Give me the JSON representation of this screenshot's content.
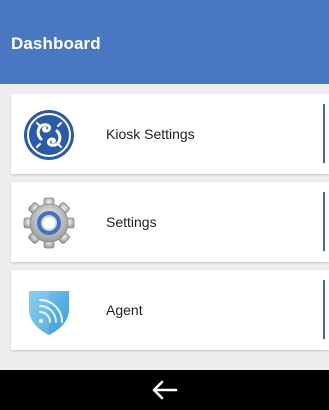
{
  "header": {
    "title": "Dashboard"
  },
  "items": [
    {
      "label": "Kiosk Settings",
      "icon": "ge-logo-icon"
    },
    {
      "label": "Settings",
      "icon": "gear-icon"
    },
    {
      "label": "Agent",
      "icon": "shield-wifi-icon"
    }
  ],
  "nav": {
    "back_icon": "back-arrow-icon"
  },
  "colors": {
    "header": "#4a77c2",
    "accent": "#3b6bbf",
    "list_background": "#eeeeee",
    "navbar": "#000000"
  }
}
